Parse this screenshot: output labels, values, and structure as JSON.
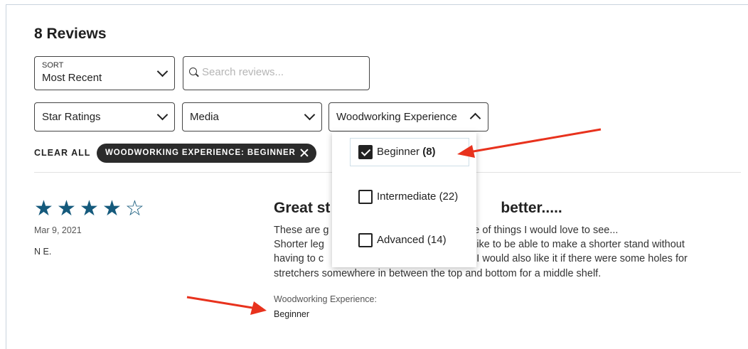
{
  "header": {
    "title": "8 Reviews"
  },
  "sort": {
    "label": "SORT",
    "value": "Most Recent"
  },
  "search": {
    "placeholder": "Search reviews..."
  },
  "filters": [
    {
      "label": "Star Ratings",
      "expanded": false
    },
    {
      "label": "Media",
      "expanded": false
    },
    {
      "label": "Woodworking Experience",
      "expanded": true
    }
  ],
  "active_filters": {
    "clear_label": "CLEAR ALL",
    "chip_label": "WOODWORKING EXPERIENCE: BEGINNER"
  },
  "dropdown": {
    "options": [
      {
        "label": "Beginner",
        "count": "(8)",
        "checked": true
      },
      {
        "label": "Intermediate",
        "count": "(22)",
        "checked": false
      },
      {
        "label": "Advanced",
        "count": "(14)",
        "checked": false
      }
    ]
  },
  "review": {
    "rating": 4,
    "max_rating": 5,
    "date": "Mar 9, 2021",
    "author": "N E.",
    "title_left": "Great st",
    "title_right": "better.....",
    "body_lines": [
      {
        "left": "These are g",
        "right": "ple of things I would love to see..."
      },
      {
        "left": "Shorter leg",
        "right": "d like to be able to make a shorter stand without"
      },
      {
        "left": "having to c",
        "right": "s! I would also like it if there were some holes for"
      },
      {
        "left": "stretchers somewhere in between the top and bottom for a middle shelf.",
        "right": ""
      }
    ],
    "experience_label": "Woodworking Experience:",
    "experience_value": "Beginner"
  },
  "colors": {
    "star": "#155a7c",
    "chip_bg": "#2b2b2b",
    "arrow": "#e8321d"
  }
}
